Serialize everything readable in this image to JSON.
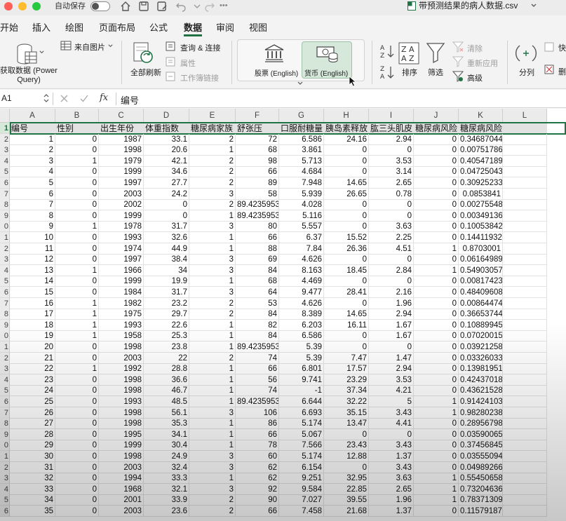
{
  "titlebar": {
    "autosave_label": "自动保存",
    "document_title": "带预测结果的病人数据.csv"
  },
  "tabs": [
    "开始",
    "插入",
    "绘图",
    "页面布局",
    "公式",
    "数据",
    "审阅",
    "视图"
  ],
  "active_tab": "数据",
  "ribbon": {
    "get_data": "获取数据 (Power Query)",
    "from_picture": "来自图片",
    "refresh_all": "全部刷新",
    "queries_connections": "查询 & 连接",
    "properties": "属性",
    "workbook_links": "工作簿链接",
    "stocks": "股票 (English)",
    "currencies": "货币 (English)",
    "sort": "排序",
    "filter": "筛选",
    "clear": "清除",
    "reapply": "重新应用",
    "advanced": "高级",
    "split": "分列",
    "cut1": "快",
    "cut2": "删"
  },
  "formula_bar": {
    "name_box": "A1",
    "fx": "fx",
    "content": "编号"
  },
  "columns": [
    "A",
    "B",
    "C",
    "D",
    "E",
    "F",
    "G",
    "H",
    "I",
    "J",
    "K",
    "L"
  ],
  "header_row": [
    "编号",
    "性别",
    "出生年份",
    "体重指数",
    "糖尿病家族",
    "舒张压",
    "口服耐糖量",
    "胰岛素释放",
    "肱三头肌皮",
    "糖尿病风险",
    "糖尿病风险概率",
    ""
  ],
  "row_numbers": [
    "1",
    "2",
    "3",
    "4",
    "5",
    "6",
    "7",
    "8",
    "9",
    "0",
    "1",
    "2",
    "3",
    "4",
    "5",
    "6",
    "7",
    "8",
    "9",
    "0",
    "1",
    "2",
    "3",
    "4",
    "5",
    "6",
    "7",
    "8",
    "9",
    "0",
    "1",
    "2",
    "3",
    "4",
    "5",
    "6"
  ],
  "rows": [
    [
      "1",
      "0",
      "1987",
      "33.1",
      "2",
      "72",
      "6.586",
      "24.16",
      "2.94",
      "0",
      "0.34687044"
    ],
    [
      "2",
      "0",
      "1998",
      "20.6",
      "1",
      "68",
      "3.861",
      "0",
      "0",
      "0",
      "0.00751786"
    ],
    [
      "3",
      "1",
      "1979",
      "42.1",
      "2",
      "98",
      "5.713",
      "0",
      "3.53",
      "0",
      "0.40547189"
    ],
    [
      "4",
      "0",
      "1999",
      "34.6",
      "2",
      "66",
      "4.684",
      "0",
      "3.14",
      "0",
      "0.04725043"
    ],
    [
      "5",
      "0",
      "1997",
      "27.7",
      "2",
      "89",
      "7.948",
      "14.65",
      "2.65",
      "0",
      "0.30925233"
    ],
    [
      "6",
      "0",
      "2003",
      "24.2",
      "3",
      "58",
      "5.939",
      "26.65",
      "0.78",
      "0",
      "0.0853841"
    ],
    [
      "7",
      "0",
      "2002",
      "0",
      "2",
      "89.4235953",
      "4.028",
      "0",
      "0",
      "0",
      "0.00275548"
    ],
    [
      "8",
      "0",
      "1999",
      "0",
      "1",
      "89.4235953",
      "5.116",
      "0",
      "0",
      "0",
      "0.00349136"
    ],
    [
      "9",
      "1",
      "1978",
      "31.7",
      "3",
      "80",
      "5.557",
      "0",
      "3.63",
      "0",
      "0.10053842"
    ],
    [
      "10",
      "0",
      "1993",
      "32.6",
      "1",
      "66",
      "6.37",
      "15.52",
      "2.25",
      "0",
      "0.14411932"
    ],
    [
      "11",
      "0",
      "1974",
      "44.9",
      "1",
      "88",
      "7.84",
      "26.36",
      "4.51",
      "1",
      "0.8703001"
    ],
    [
      "12",
      "0",
      "1997",
      "38.4",
      "3",
      "69",
      "4.626",
      "0",
      "0",
      "0",
      "0.06164989"
    ],
    [
      "13",
      "1",
      "1966",
      "34",
      "3",
      "84",
      "8.163",
      "18.45",
      "2.84",
      "1",
      "0.54903057"
    ],
    [
      "14",
      "0",
      "1999",
      "19.9",
      "1",
      "68",
      "4.469",
      "0",
      "0",
      "0",
      "0.00817423"
    ],
    [
      "15",
      "0",
      "1984",
      "31.7",
      "3",
      "64",
      "9.477",
      "28.41",
      "2.16",
      "0",
      "0.48409608"
    ],
    [
      "16",
      "1",
      "1982",
      "23.2",
      "2",
      "53",
      "4.626",
      "0",
      "1.96",
      "0",
      "0.00864474"
    ],
    [
      "17",
      "1",
      "1975",
      "29.7",
      "2",
      "84",
      "8.389",
      "14.65",
      "2.94",
      "0",
      "0.36653744"
    ],
    [
      "18",
      "1",
      "1993",
      "22.6",
      "1",
      "82",
      "6.203",
      "16.11",
      "1.67",
      "0",
      "0.10889945"
    ],
    [
      "19",
      "1",
      "1958",
      "25.3",
      "1",
      "84",
      "6.586",
      "0",
      "1.67",
      "0",
      "0.07020015"
    ],
    [
      "20",
      "0",
      "1998",
      "23.8",
      "1",
      "89.4235953",
      "5.39",
      "0",
      "0",
      "0",
      "0.03921258"
    ],
    [
      "21",
      "0",
      "2003",
      "22",
      "2",
      "74",
      "5.39",
      "7.47",
      "1.47",
      "0",
      "0.03326033"
    ],
    [
      "22",
      "1",
      "1992",
      "28.8",
      "1",
      "66",
      "6.801",
      "17.57",
      "2.94",
      "0",
      "0.13981951"
    ],
    [
      "23",
      "0",
      "1998",
      "36.6",
      "1",
      "56",
      "9.741",
      "23.29",
      "3.53",
      "0",
      "0.42437018"
    ],
    [
      "24",
      "0",
      "1998",
      "46.7",
      "1",
      "74",
      "-1",
      "37.34",
      "4.21",
      "0",
      "0.43621528"
    ],
    [
      "25",
      "0",
      "1993",
      "48.5",
      "1",
      "89.4235953",
      "6.644",
      "32.22",
      "5",
      "1",
      "0.91424103"
    ],
    [
      "26",
      "0",
      "1998",
      "56.1",
      "3",
      "106",
      "6.693",
      "35.15",
      "3.43",
      "1",
      "0.98280238"
    ],
    [
      "27",
      "0",
      "1998",
      "35.3",
      "1",
      "86",
      "5.174",
      "13.47",
      "4.41",
      "0",
      "0.28956798"
    ],
    [
      "28",
      "0",
      "1995",
      "34.1",
      "1",
      "66",
      "5.067",
      "0",
      "0",
      "0",
      "0.03590065"
    ],
    [
      "29",
      "0",
      "1999",
      "30.4",
      "1",
      "78",
      "7.566",
      "23.43",
      "3.43",
      "0",
      "0.37456845"
    ],
    [
      "30",
      "0",
      "1998",
      "24.9",
      "3",
      "60",
      "5.174",
      "12.88",
      "1.37",
      "0",
      "0.03555094"
    ],
    [
      "31",
      "0",
      "2003",
      "32.4",
      "3",
      "62",
      "6.154",
      "0",
      "3.43",
      "0",
      "0.04989266"
    ],
    [
      "32",
      "0",
      "1994",
      "33.3",
      "1",
      "62",
      "9.251",
      "32.95",
      "3.63",
      "1",
      "0.55450658"
    ],
    [
      "33",
      "0",
      "1968",
      "32.1",
      "3",
      "92",
      "9.584",
      "22.85",
      "2.65",
      "1",
      "0.73204636"
    ],
    [
      "34",
      "0",
      "2001",
      "33.9",
      "2",
      "90",
      "7.027",
      "39.55",
      "1.96",
      "1",
      "0.78371309"
    ],
    [
      "35",
      "0",
      "2003",
      "23.6",
      "2",
      "66",
      "7.458",
      "21.68",
      "1.37",
      "0",
      "0.11579187"
    ]
  ],
  "colors": {
    "accent": "#217346",
    "selection_fill": "#d5e8d9"
  }
}
